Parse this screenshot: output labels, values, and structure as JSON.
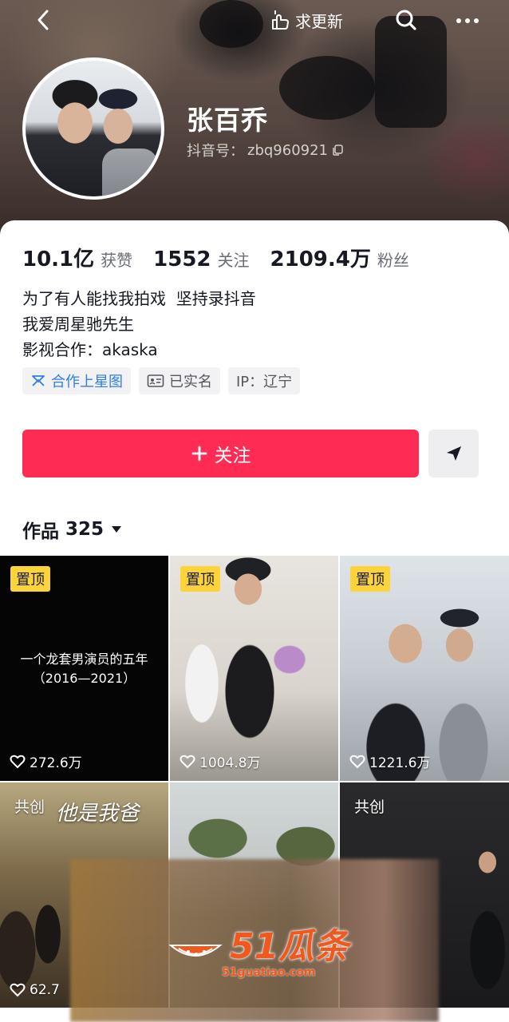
{
  "header": {
    "update_label": "求更新",
    "icons": {
      "back": "chevron-left-icon",
      "update": "hand-point-icon",
      "search": "search-icon",
      "more": "more-dots-icon"
    }
  },
  "profile": {
    "name": "张百乔",
    "douyin_id_label": "抖音号：",
    "douyin_id": "zbq960921",
    "stats": [
      {
        "value": "10.1亿",
        "label": "获赞"
      },
      {
        "value": "1552",
        "label": "关注"
      },
      {
        "value": "2109.4万",
        "label": "粉丝"
      }
    ],
    "bio": [
      "为了有人能找我拍戏  坚持录抖音",
      "我爱周星驰先生",
      "影视合作：akaska"
    ],
    "tags": [
      {
        "label": "合作上星图",
        "icon": "star-map-icon"
      },
      {
        "label": "已实名",
        "icon": "id-card-icon"
      },
      {
        "label": "IP：辽宁",
        "icon": ""
      }
    ],
    "follow_label": "关注",
    "share_icon": "send-icon"
  },
  "works": {
    "label": "作品",
    "count": "325",
    "tiles": [
      {
        "badge": "置顶",
        "text_line1": "一个龙套男演员的五年",
        "text_line2": "（2016—2021）",
        "likes": "272.6万"
      },
      {
        "badge": "置顶",
        "likes": "1004.8万"
      },
      {
        "badge": "置顶",
        "likes": "1221.6万"
      },
      {
        "badge": "共创",
        "title_text": "他是我爸",
        "likes": "62.7"
      },
      {
        "badge": "",
        "likes": ""
      },
      {
        "badge": "共创",
        "likes": ""
      }
    ]
  },
  "watermark": {
    "brand": "51瓜条",
    "url": "51guatiao.com"
  },
  "colors": {
    "accent": "#fe2c55",
    "pin": "#fdd33a",
    "watermark": "#f0581e",
    "tag_blue": "#2f7ee6"
  }
}
